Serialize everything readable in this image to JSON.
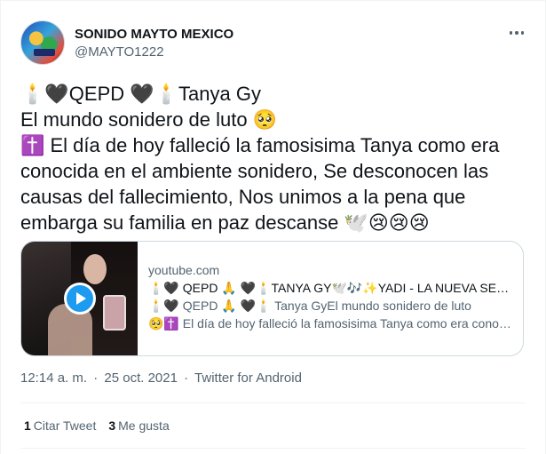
{
  "author": {
    "display_name": "SONIDO MAYTO MEXICO",
    "handle": "@MAYTO1222",
    "avatar_icon": "avatar-image"
  },
  "tweet": {
    "lines": [
      "🕯️🖤QEPD 🖤🕯️Tanya Gy",
      "El mundo sonidero de luto 🥺",
      "✝️ El día de hoy falleció la famosisima Tanya como era conocida en el ambiente sonidero, Se desconocen las causas del fallecimiento, Nos unimos a la pena que embarga su familia en paz descanse 🕊️😢😢😢"
    ]
  },
  "card": {
    "domain": "youtube.com",
    "title": "🕯️🖤 QEPD 🙏 🖤🕯️TANYA GY🕊️🎶✨YADI - LA NUEVA SENSACIÓN SONIDERA",
    "desc_line1": "🕯️🖤 QEPD 🙏 🖤🕯️ Tanya GyEl mundo sonidero de luto",
    "desc_line2": "🥺✝️ El día de hoy falleció la famosisima Tanya como era conocida en el ambiente sonidero",
    "thumbnail_icon": "play-icon"
  },
  "meta": {
    "time": "12:14 a. m.",
    "date": "25 oct. 2021",
    "source": "Twitter for Android",
    "separator": "·"
  },
  "stats": {
    "quote_count": "1",
    "quote_label": "Citar Tweet",
    "like_count": "3",
    "like_label": "Me gusta"
  },
  "colors": {
    "accent": "#1d9bf0",
    "secondary_text": "#536471",
    "primary_text": "#0f1419",
    "border": "#cfd9de"
  }
}
